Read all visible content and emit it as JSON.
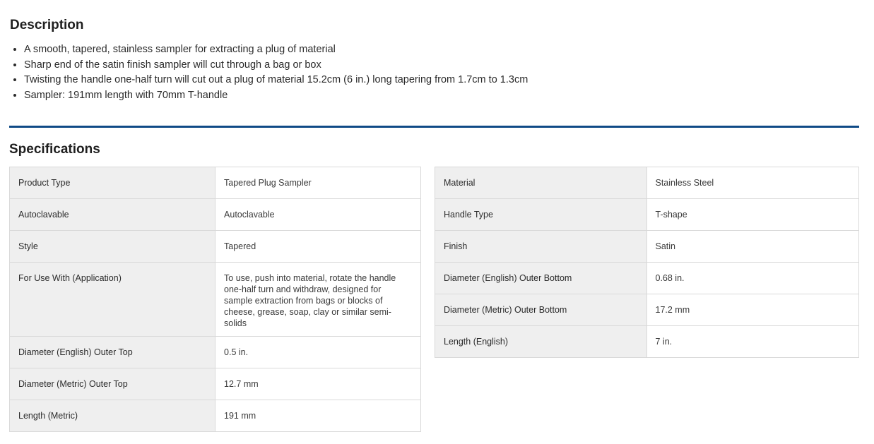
{
  "description": {
    "heading": "Description",
    "bullets": [
      "A smooth, tapered, stainless sampler for extracting a plug of material",
      "Sharp end of the satin finish sampler will cut through a bag or box",
      "Twisting the handle one-half turn will cut out a plug of material 15.2cm (6 in.) long tapering from 1.7cm to 1.3cm",
      "Sampler: 191mm length with 70mm T-handle"
    ]
  },
  "specifications": {
    "heading": "Specifications",
    "left": [
      {
        "label": "Product Type",
        "value": "Tapered Plug Sampler"
      },
      {
        "label": "Autoclavable",
        "value": "Autoclavable"
      },
      {
        "label": "Style",
        "value": "Tapered"
      },
      {
        "label": "For Use With (Application)",
        "value": "To use, push into material, rotate the handle one-half turn and withdraw, designed for sample extraction from bags or blocks of cheese, grease, soap, clay or similar semi-solids"
      },
      {
        "label": "Diameter (English) Outer Top",
        "value": "0.5 in."
      },
      {
        "label": "Diameter (Metric) Outer Top",
        "value": "12.7 mm"
      },
      {
        "label": "Length (Metric)",
        "value": "191 mm"
      }
    ],
    "right": [
      {
        "label": "Material",
        "value": "Stainless Steel"
      },
      {
        "label": "Handle Type",
        "value": "T-shape"
      },
      {
        "label": "Finish",
        "value": "Satin"
      },
      {
        "label": "Diameter (English) Outer Bottom",
        "value": "0.68 in."
      },
      {
        "label": "Diameter (Metric) Outer Bottom",
        "value": "17.2 mm"
      },
      {
        "label": "Length (English)",
        "value": "7 in."
      }
    ]
  },
  "colors": {
    "divider": "#0f4a86",
    "label_cell_bg": "#efefef",
    "border": "#d9d9d9"
  }
}
